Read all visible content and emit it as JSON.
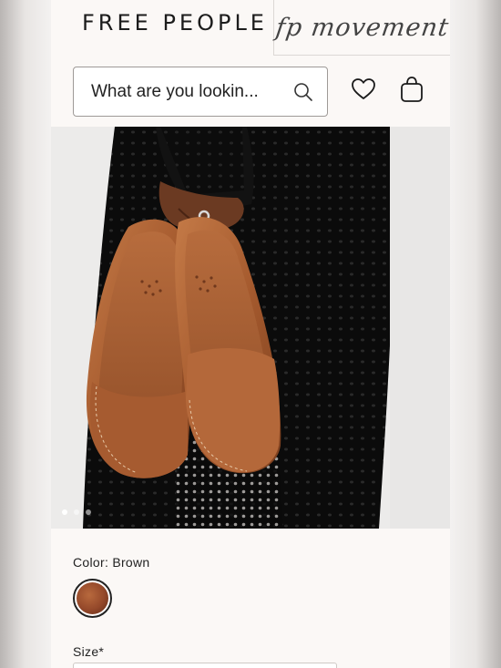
{
  "header": {
    "brand": "FREE PEOPLE",
    "movement_tab": "fp movement"
  },
  "search": {
    "placeholder": "What are you lookin..."
  },
  "icons": {
    "search": "search-icon",
    "wishlist": "heart-icon",
    "bag": "shopping-bag-icon"
  },
  "hero": {
    "image_alt": "Hand holding pair of brown leather slide sandals",
    "carousel_dots": 3,
    "active_dot": 1
  },
  "product": {
    "color_label": "Color: Brown",
    "swatch_color": "#94482a",
    "size_label": "Size*"
  }
}
